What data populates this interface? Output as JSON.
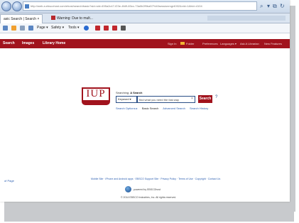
{
  "browser": {
    "url_prefix": "http://web.a.ebscohost.com/ehost/search/basic?sid=",
    "url_domain": "ebscohost.com",
    "url_rest": "sid=455a2c47-f23e-4fd9-83cc-73a0b2f9ba57%40sessionmgr4002&vid=1&hid=4104",
    "tabs": [
      {
        "label": "asic Search | Search  ×"
      },
      {
        "label": "Warning: Due to mult..."
      }
    ],
    "commands": {
      "page": "Page ▾",
      "safety": "Safety ▾",
      "tools": "Tools ▾"
    }
  },
  "site_header": {
    "nav": [
      "Search",
      "Images",
      "Library Home"
    ],
    "util": [
      "Sign In",
      "Folder",
      "Preferences",
      "Languages ▾",
      "Ask A Librarian",
      "New Features"
    ]
  },
  "search": {
    "searching_label": "Searching:",
    "searching_target": "A Search",
    "keyword_select": "Keyword ▾",
    "input_value": "find what you need the fast way",
    "clear_x": "×",
    "button_label": "Search",
    "help": "?",
    "options": [
      "Search Options ▸",
      "Basic Search",
      "Advanced Search",
      "Search History"
    ],
    "logo_text": "IUP"
  },
  "footer": {
    "left_link": "of Page",
    "links": "Mobile Site  ·  iPhone and Android apps  ·  EBSCO Support Site  ·  Privacy Policy  ·  Terms of Use  ·  Copyright  ·  Contact Us",
    "powered": "powered by EBSCOhost",
    "copyright": "© 2014 EBSCO Industries, Inc. All rights reserved."
  },
  "colors": {
    "brand_red": "#a1131d",
    "link_blue": "#2a5db0"
  }
}
